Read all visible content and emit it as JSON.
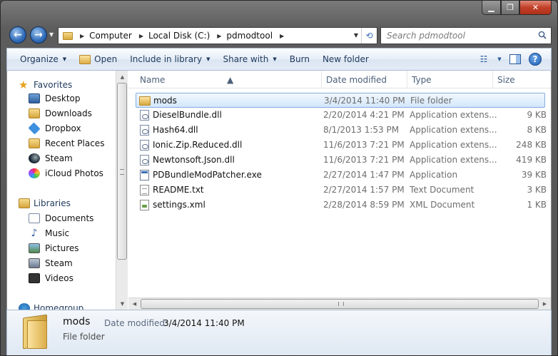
{
  "window": {
    "caption": {
      "minimize": "▁",
      "maximize": "❐",
      "close": "✕"
    },
    "colors": {
      "selection_border": "#84acdd",
      "selection_fill": "#d3e7fb",
      "link_text": "#1e395b"
    }
  },
  "address_bar": {
    "breadcrumbs": [
      "Computer",
      "Local Disk (C:)",
      "pdmodtool"
    ],
    "separator": "▶",
    "dropdown": "▼",
    "refresh": "⟲"
  },
  "search": {
    "placeholder": "Search pdmodtool"
  },
  "toolbar": {
    "organize": "Organize",
    "open": "Open",
    "include_in_library": "Include in library",
    "share_with": "Share with",
    "burn": "Burn",
    "new_folder": "New folder",
    "arrow": "▼",
    "views_icon": "☷",
    "help": "?"
  },
  "nav_pane": {
    "favorites": {
      "label": "Favorites",
      "items": [
        "Desktop",
        "Downloads",
        "Dropbox",
        "Recent Places",
        "Steam",
        "iCloud Photos"
      ]
    },
    "libraries": {
      "label": "Libraries",
      "items": [
        "Documents",
        "Music",
        "Pictures",
        "Steam",
        "Videos"
      ]
    },
    "homegroup": {
      "label": "Homegroup"
    }
  },
  "columns": {
    "name": "Name",
    "date": "Date modified",
    "type": "Type",
    "size": "Size"
  },
  "files": [
    {
      "name": "mods",
      "date": "3/4/2014 11:40 PM",
      "type": "File folder",
      "size": "",
      "icon": "folder-icon",
      "selected": true
    },
    {
      "name": "DieselBundle.dll",
      "date": "2/20/2014 4:21 PM",
      "type": "Application extens...",
      "size": "9 KB",
      "icon": "dll-icon"
    },
    {
      "name": "Hash64.dll",
      "date": "8/1/2013 1:53 PM",
      "type": "Application extens...",
      "size": "8 KB",
      "icon": "dll-icon"
    },
    {
      "name": "Ionic.Zip.Reduced.dll",
      "date": "11/6/2013 7:21 PM",
      "type": "Application extens...",
      "size": "248 KB",
      "icon": "dll-icon"
    },
    {
      "name": "Newtonsoft.Json.dll",
      "date": "11/6/2013 7:21 PM",
      "type": "Application extens...",
      "size": "419 KB",
      "icon": "dll-icon"
    },
    {
      "name": "PDBundleModPatcher.exe",
      "date": "2/27/2014 1:47 PM",
      "type": "Application",
      "size": "39 KB",
      "icon": "exe-icon"
    },
    {
      "name": "README.txt",
      "date": "2/27/2014 1:57 PM",
      "type": "Text Document",
      "size": "3 KB",
      "icon": "txt-icon"
    },
    {
      "name": "settings.xml",
      "date": "2/28/2014 8:59 PM",
      "type": "XML Document",
      "size": "1 KB",
      "icon": "xml-icon"
    }
  ],
  "details": {
    "name": "mods",
    "type": "File folder",
    "modified_label": "Date modified:",
    "modified_value": "3/4/2014 11:40 PM"
  }
}
